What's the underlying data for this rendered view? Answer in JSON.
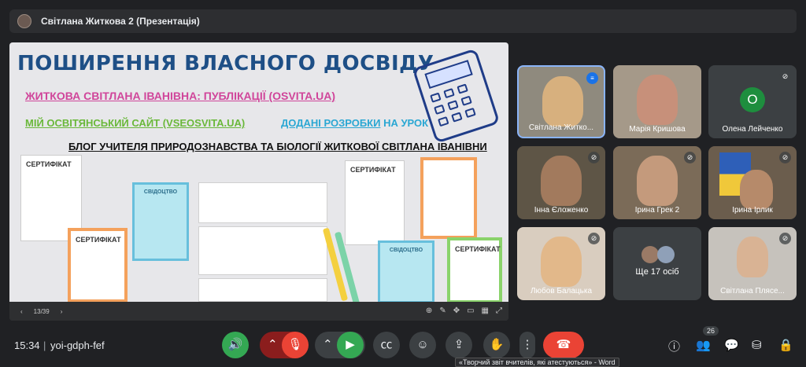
{
  "topbar": {
    "title": "Світлана Житкова 2 (Презентація)"
  },
  "slide": {
    "heading": "ПОШИРЕННЯ ВЛАСНОГО ДОСВІДУ",
    "line1": "ЖИТКОВА СВІТЛАНА ІВАНІВНА: ПУБЛІКАЦІЇ (OSVITA.UA)",
    "line2": "МІЙ ОСВІТЯНСЬКИЙ САЙТ (VSEOSVITA.UA)",
    "line3_link": "ДОДАНІ РОЗРОБКИ",
    "line3_rest": " НА УРОК",
    "line4": "БЛОГ УЧИТЕЛЯ ПРИРОДОЗНАВСТВА ТА БІОЛОГІЇ ЖИТКОВОЇ СВІТЛАНА ІВАНІВНИ",
    "cert_label": "СЕРТИФІКАТ",
    "svid_label": "СВІДОЦТВО",
    "page": "13/39"
  },
  "participants": [
    {
      "name": "Світлана Житко...",
      "state": "speaking"
    },
    {
      "name": "Марія Кришова",
      "state": "video"
    },
    {
      "name": "Олена Лейченко",
      "state": "muted",
      "initial": "О"
    },
    {
      "name": "Інна Єложенко",
      "state": "muted"
    },
    {
      "name": "Ірина Грек 2",
      "state": "muted"
    },
    {
      "name": "Ірина Ірлик",
      "state": "muted"
    },
    {
      "name": "Любов Балацька",
      "state": "muted"
    },
    {
      "name": "Ще 17 осіб",
      "state": "more"
    },
    {
      "name": "Світлана Плясе...",
      "state": "muted"
    }
  ],
  "bottom": {
    "time": "15:34",
    "separator": "|",
    "meeting_code": "yoi-gdph-fef",
    "people_count": "26",
    "tooltip": "«Творчий звіт вчителів, які атестуються» - Word"
  },
  "colors": {
    "accent": "#8ab4f8",
    "green": "#34a853",
    "red": "#ea4335",
    "bg": "#202124"
  }
}
